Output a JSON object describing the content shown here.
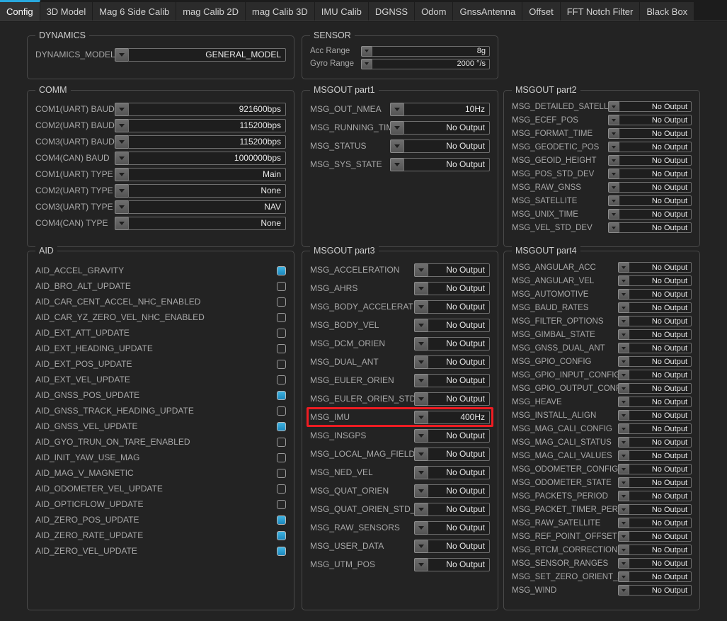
{
  "tabs": [
    {
      "label": "Config",
      "active": true
    },
    {
      "label": "3D Model",
      "active": false
    },
    {
      "label": "Mag 6 Side Calib",
      "active": false
    },
    {
      "label": "mag Calib 2D",
      "active": false
    },
    {
      "label": "mag Calib 3D",
      "active": false
    },
    {
      "label": "IMU Calib",
      "active": false
    },
    {
      "label": "DGNSS",
      "active": false
    },
    {
      "label": "Odom",
      "active": false
    },
    {
      "label": "GnssAntenna",
      "active": false
    },
    {
      "label": "Offset",
      "active": false
    },
    {
      "label": "FFT Notch Filter",
      "active": false
    },
    {
      "label": "Black Box",
      "active": false
    }
  ],
  "colors": {
    "accent": "#29a8dd",
    "highlight": "#ee1c22",
    "checkbox_on": "#2f9fd4",
    "background": "#232323",
    "group_border": "#4a4a4a"
  },
  "dynamics": {
    "title": "DYNAMICS",
    "rows": [
      {
        "label": "DYNAMICS_MODEL",
        "value": "GENERAL_MODEL"
      }
    ]
  },
  "comm": {
    "title": "COMM",
    "rows": [
      {
        "label": "COM1(UART) BAUD",
        "value": "921600bps"
      },
      {
        "label": "COM2(UART) BAUD",
        "value": "115200bps"
      },
      {
        "label": "COM3(UART) BAUD",
        "value": "115200bps"
      },
      {
        "label": "COM4(CAN) BAUD",
        "value": "1000000bps"
      },
      {
        "label": "COM1(UART) TYPE",
        "value": "Main"
      },
      {
        "label": "COM2(UART) TYPE",
        "value": "None"
      },
      {
        "label": "COM3(UART) TYPE",
        "value": "NAV"
      },
      {
        "label": "COM4(CAN) TYPE",
        "value": "None"
      }
    ]
  },
  "aid": {
    "title": "AID",
    "rows": [
      {
        "label": "AID_ACCEL_GRAVITY",
        "checked": true
      },
      {
        "label": "AID_BRO_ALT_UPDATE",
        "checked": false
      },
      {
        "label": "AID_CAR_CENT_ACCEL_NHC_ENABLED",
        "checked": false
      },
      {
        "label": "AID_CAR_YZ_ZERO_VEL_NHC_ENABLED",
        "checked": false
      },
      {
        "label": "AID_EXT_ATT_UPDATE",
        "checked": false
      },
      {
        "label": "AID_EXT_HEADING_UPDATE",
        "checked": false
      },
      {
        "label": "AID_EXT_POS_UPDATE",
        "checked": false
      },
      {
        "label": "AID_EXT_VEL_UPDATE",
        "checked": false
      },
      {
        "label": "AID_GNSS_POS_UPDATE",
        "checked": true
      },
      {
        "label": "AID_GNSS_TRACK_HEADING_UPDATE",
        "checked": false
      },
      {
        "label": "AID_GNSS_VEL_UPDATE",
        "checked": true
      },
      {
        "label": "AID_GYO_TRUN_ON_TARE_ENABLED",
        "checked": false
      },
      {
        "label": "AID_INIT_YAW_USE_MAG",
        "checked": false
      },
      {
        "label": "AID_MAG_V_MAGNETIC",
        "checked": false
      },
      {
        "label": "AID_ODOMETER_VEL_UPDATE",
        "checked": false
      },
      {
        "label": "AID_OPTICFLOW_UPDATE",
        "checked": false
      },
      {
        "label": "AID_ZERO_POS_UPDATE",
        "checked": true
      },
      {
        "label": "AID_ZERO_RATE_UPDATE",
        "checked": true
      },
      {
        "label": "AID_ZERO_VEL_UPDATE",
        "checked": true
      }
    ]
  },
  "sensor": {
    "title": "SENSOR",
    "rows": [
      {
        "label": "Acc Range",
        "value": "8g"
      },
      {
        "label": "Gyro Range",
        "value": "2000 °/s"
      }
    ]
  },
  "msgout_part1": {
    "title": "MSGOUT part1",
    "rows": [
      {
        "label": "MSG_OUT_NMEA",
        "value": "10Hz"
      },
      {
        "label": "MSG_RUNNING_TIME",
        "value": "No Output"
      },
      {
        "label": "MSG_STATUS",
        "value": "No Output"
      },
      {
        "label": "MSG_SYS_STATE",
        "value": "No Output"
      }
    ]
  },
  "msgout_part2": {
    "title": "MSGOUT part2",
    "rows": [
      {
        "label": "MSG_DETAILED_SATELLITE",
        "value": "No Output"
      },
      {
        "label": "MSG_ECEF_POS",
        "value": "No Output"
      },
      {
        "label": "MSG_FORMAT_TIME",
        "value": "No Output"
      },
      {
        "label": "MSG_GEODETIC_POS",
        "value": "No Output"
      },
      {
        "label": "MSG_GEOID_HEIGHT",
        "value": "No Output"
      },
      {
        "label": "MSG_POS_STD_DEV",
        "value": "No Output"
      },
      {
        "label": "MSG_RAW_GNSS",
        "value": "No Output"
      },
      {
        "label": "MSG_SATELLITE",
        "value": "No Output"
      },
      {
        "label": "MSG_UNIX_TIME",
        "value": "No Output"
      },
      {
        "label": "MSG_VEL_STD_DEV",
        "value": "No Output"
      }
    ]
  },
  "msgout_part3": {
    "title": "MSGOUT part3",
    "rows": [
      {
        "label": "MSG_ACCELERATION",
        "value": "No Output",
        "highlight": false
      },
      {
        "label": "MSG_AHRS",
        "value": "No Output",
        "highlight": false
      },
      {
        "label": "MSG_BODY_ACCELERATION",
        "value": "No Output",
        "highlight": false
      },
      {
        "label": "MSG_BODY_VEL",
        "value": "No Output",
        "highlight": false
      },
      {
        "label": "MSG_DCM_ORIEN",
        "value": "No Output",
        "highlight": false
      },
      {
        "label": "MSG_DUAL_ANT",
        "value": "No Output",
        "highlight": false
      },
      {
        "label": "MSG_EULER_ORIEN",
        "value": "No Output",
        "highlight": false
      },
      {
        "label": "MSG_EULER_ORIEN_STD_DEV",
        "value": "No Output",
        "highlight": false
      },
      {
        "label": "MSG_IMU",
        "value": "400Hz",
        "highlight": true
      },
      {
        "label": "MSG_INSGPS",
        "value": "No Output",
        "highlight": false
      },
      {
        "label": "MSG_LOCAL_MAG_FIELD",
        "value": "No Output",
        "highlight": false
      },
      {
        "label": "MSG_NED_VEL",
        "value": "No Output",
        "highlight": false
      },
      {
        "label": "MSG_QUAT_ORIEN",
        "value": "No Output",
        "highlight": false
      },
      {
        "label": "MSG_QUAT_ORIEN_STD_DEV",
        "value": "No Output",
        "highlight": false
      },
      {
        "label": "MSG_RAW_SENSORS",
        "value": "No Output",
        "highlight": false
      },
      {
        "label": "MSG_USER_DATA",
        "value": "No Output",
        "highlight": false
      },
      {
        "label": "MSG_UTM_POS",
        "value": "No Output",
        "highlight": false
      }
    ]
  },
  "msgout_part4": {
    "title": "MSGOUT part4",
    "rows": [
      {
        "label": "MSG_ANGULAR_ACC",
        "value": "No Output"
      },
      {
        "label": "MSG_ANGULAR_VEL",
        "value": "No Output"
      },
      {
        "label": "MSG_AUTOMOTIVE",
        "value": "No Output"
      },
      {
        "label": "MSG_BAUD_RATES",
        "value": "No Output"
      },
      {
        "label": "MSG_FILTER_OPTIONS",
        "value": "No Output"
      },
      {
        "label": "MSG_GIMBAL_STATE",
        "value": "No Output"
      },
      {
        "label": "MSG_GNSS_DUAL_ANT",
        "value": "No Output"
      },
      {
        "label": "MSG_GPIO_CONFIG",
        "value": "No Output"
      },
      {
        "label": "MSG_GPIO_INPUT_CONFIG",
        "value": "No Output"
      },
      {
        "label": "MSG_GPIO_OUTPUT_CONFIG",
        "value": "No Output"
      },
      {
        "label": "MSG_HEAVE",
        "value": "No Output"
      },
      {
        "label": "MSG_INSTALL_ALIGN",
        "value": "No Output"
      },
      {
        "label": "MSG_MAG_CALI_CONFIG",
        "value": "No Output"
      },
      {
        "label": "MSG_MAG_CALI_STATUS",
        "value": "No Output"
      },
      {
        "label": "MSG_MAG_CALI_VALUES",
        "value": "No Output"
      },
      {
        "label": "MSG_ODOMETER_CONFIG",
        "value": "No Output"
      },
      {
        "label": "MSG_ODOMETER_STATE",
        "value": "No Output"
      },
      {
        "label": "MSG_PACKETS_PERIOD",
        "value": "No Output"
      },
      {
        "label": "MSG_PACKET_TIMER_PERIOD",
        "value": "No Output"
      },
      {
        "label": "MSG_RAW_SATELLITE",
        "value": "No Output"
      },
      {
        "label": "MSG_REF_POINT_OFFSET",
        "value": "No Output"
      },
      {
        "label": "MSG_RTCM_CORRECTIONS",
        "value": "No Output"
      },
      {
        "label": "MSG_SENSOR_RANGES",
        "value": "No Output"
      },
      {
        "label": "MSG_SET_ZERO_ORIENT_ALIGN",
        "value": "No Output"
      },
      {
        "label": "MSG_WIND",
        "value": "No Output"
      }
    ]
  }
}
